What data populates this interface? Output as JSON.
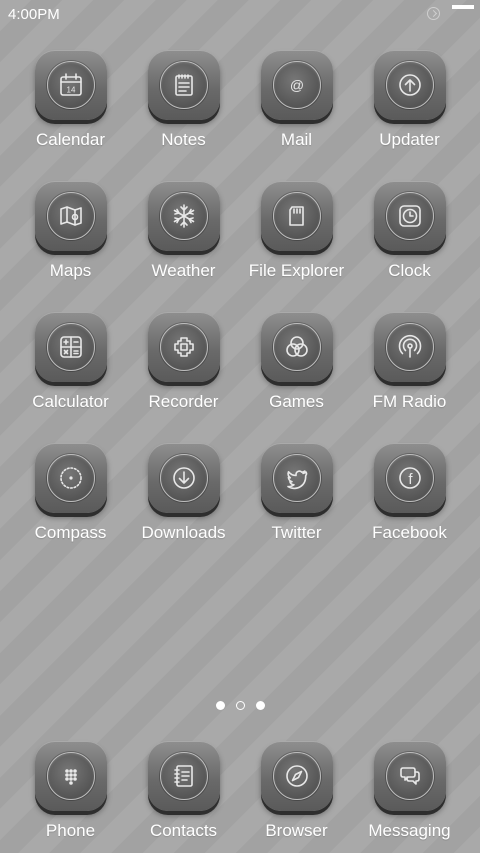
{
  "status_bar": {
    "time": "4:00PM"
  },
  "apps": [
    {
      "label": "Calendar",
      "icon": "calendar-icon",
      "day": "14"
    },
    {
      "label": "Notes",
      "icon": "notes-icon"
    },
    {
      "label": "Mail",
      "icon": "mail-icon",
      "glyph": "@"
    },
    {
      "label": "Updater",
      "icon": "updater-icon"
    },
    {
      "label": "Maps",
      "icon": "map-icon"
    },
    {
      "label": "Weather",
      "icon": "snowflake-icon"
    },
    {
      "label": "File Explorer",
      "icon": "sd-card-icon"
    },
    {
      "label": "Clock",
      "icon": "clock-icon"
    },
    {
      "label": "Calculator",
      "icon": "calculator-icon"
    },
    {
      "label": "Recorder",
      "icon": "recorder-icon"
    },
    {
      "label": "Games",
      "icon": "games-icon"
    },
    {
      "label": "FM Radio",
      "icon": "radio-icon"
    },
    {
      "label": "Compass",
      "icon": "compass-icon"
    },
    {
      "label": "Downloads",
      "icon": "download-icon"
    },
    {
      "label": "Twitter",
      "icon": "twitter-icon"
    },
    {
      "label": "Facebook",
      "icon": "facebook-icon",
      "glyph": "f"
    }
  ],
  "page_indicator": {
    "count": 3,
    "current": 2
  },
  "dock": [
    {
      "label": "Phone",
      "icon": "phone-dialpad-icon"
    },
    {
      "label": "Contacts",
      "icon": "contacts-icon"
    },
    {
      "label": "Browser",
      "icon": "browser-compass-icon"
    },
    {
      "label": "Messaging",
      "icon": "messaging-icon"
    }
  ]
}
